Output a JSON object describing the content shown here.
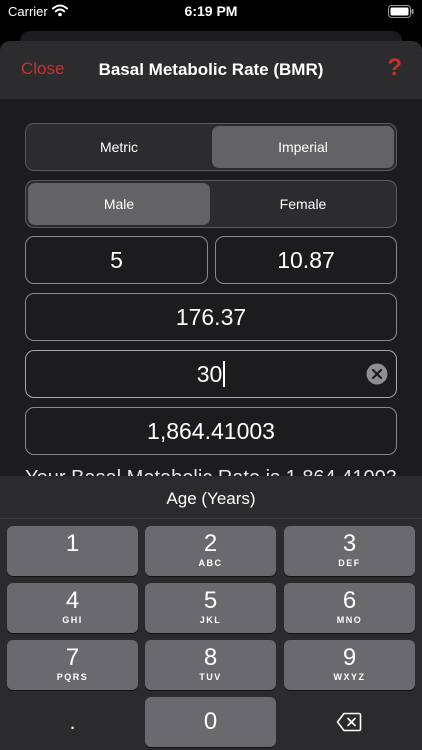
{
  "status_bar": {
    "carrier": "Carrier",
    "time": "6:19 PM",
    "icons": [
      "wifi-icon",
      "battery-icon"
    ]
  },
  "nav": {
    "close_label": "Close",
    "title": "Basal Metabolic Rate (BMR)",
    "help_label": "?"
  },
  "units": {
    "options": [
      "Metric",
      "Imperial"
    ],
    "selected": "Imperial"
  },
  "sex": {
    "options": [
      "Male",
      "Female"
    ],
    "selected": "Male"
  },
  "fields": {
    "height_feet": "5",
    "height_inches": "10.87",
    "weight": "176.37",
    "age": "30",
    "bmr": "1,864.41003"
  },
  "result_text": "Your Basal Metabolic Rate is 1,864.41003",
  "keyboard": {
    "title": "Age (Years)",
    "keys": [
      {
        "digit": "1",
        "letters": ""
      },
      {
        "digit": "2",
        "letters": "ABC"
      },
      {
        "digit": "3",
        "letters": "DEF"
      },
      {
        "digit": "4",
        "letters": "GHI"
      },
      {
        "digit": "5",
        "letters": "JKL"
      },
      {
        "digit": "6",
        "letters": "MNO"
      },
      {
        "digit": "7",
        "letters": "PQRS"
      },
      {
        "digit": "8",
        "letters": "TUV"
      },
      {
        "digit": "9",
        "letters": "WXYZ"
      }
    ],
    "dot_label": ".",
    "zero_label": "0",
    "backspace_icon": "backspace-icon"
  },
  "colors": {
    "accent": "#c9302c",
    "selected_segment": "#636366",
    "sheet_background": "#1c1c1e",
    "key_background": "#6a6a6e"
  }
}
